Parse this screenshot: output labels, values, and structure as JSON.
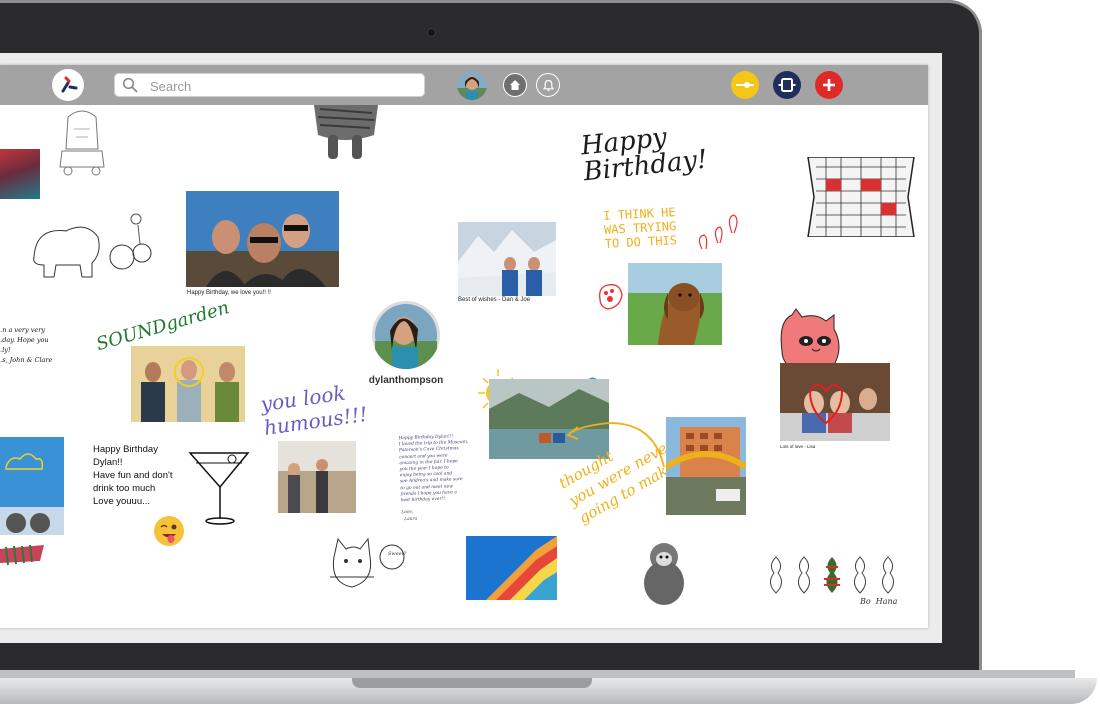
{
  "search": {
    "placeholder": "Search"
  },
  "profile": {
    "username": "dylanthompson"
  },
  "posts": {
    "selfie_caption": "Happy Birthday, we love you!! !!",
    "mountain_caption": "Best of wishes - Dan & Joe",
    "family_caption": "Lots of love - Lisa",
    "note_left_top": "...n a very very\n...day. Hope you\n...ly!\n...s, John & Clare",
    "note_birthday": "Happy Birthday\nDylan!!\nHave fun and don't\ndrink too much\nLove youuu...",
    "letter": "Happy Birthday Dylan!!!\nI loved the trip to the Museum,\nPaterson's Cave Christmas\nconcert and you were\namazing in the fair. I hope\nyou the year I hope to\nenjoy being so cool and\nsee Andrea's and make sure\nto go out and meet new\nfriends I hope you have a\nbest birthday ever!!\n\nLove,\n  Laura",
    "happy_birthday": "Happy\nBirthday!",
    "dog_text": "I THINK HE\nWAS TRYING\nTO DO THIS",
    "you_look": "you look\nhumous!!!",
    "soundgarden": "SOUNDgarden",
    "thought_text": "thought\nyou were never\ngoing to make it",
    "cat_bubble": "Sweet?",
    "signature": "Bo  Hana"
  },
  "colors": {
    "topbar": "#a3a3a3",
    "accent_yellow": "#f5c518",
    "accent_navy": "#1f2f5b",
    "accent_red": "#e02a2a",
    "handwriting_orange": "#f0b019",
    "handwriting_purple": "#6b5bc4",
    "handwriting_green": "#1e7a2e"
  },
  "icons": {
    "logo": "app-logo-icon",
    "search": "search-icon",
    "home": "home-icon",
    "bell": "bell-icon",
    "connect": "connect-icon",
    "frame": "frame-icon",
    "add": "plus-icon"
  }
}
